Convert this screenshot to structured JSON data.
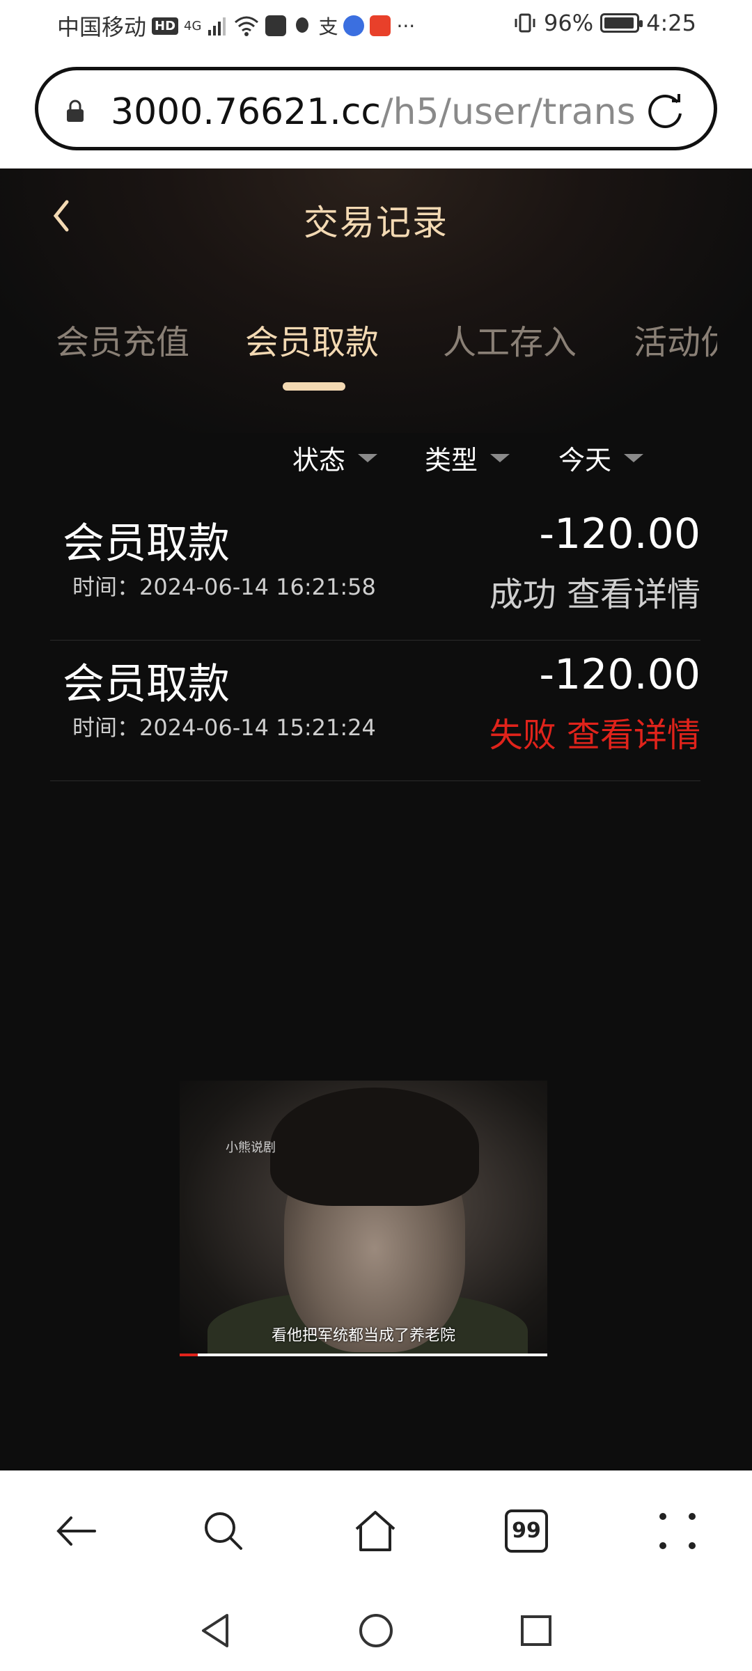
{
  "status_bar": {
    "carrier": "中国移动",
    "hd": "HD",
    "network": "4G",
    "battery_percent": "96%",
    "battery_level": 0.96,
    "time": "4:25"
  },
  "browser": {
    "url_host": "3000.76621.cc",
    "url_path": "/h5/user/trans",
    "tabs_count": "99"
  },
  "page": {
    "title": "交易记录",
    "tabs": [
      {
        "label": "会员充值",
        "active": false
      },
      {
        "label": "会员取款",
        "active": true
      },
      {
        "label": "人工存入",
        "active": false
      },
      {
        "label": "活动优",
        "active": false
      }
    ],
    "filters": [
      {
        "label": "状态"
      },
      {
        "label": "类型"
      },
      {
        "label": "今天"
      }
    ],
    "records": [
      {
        "title": "会员取款",
        "time": "时间：2024-06-14 16:21:58",
        "amount": "-120.00",
        "status": "成功",
        "detail_link": "查看详情",
        "status_color": "#cfcfcf"
      },
      {
        "title": "会员取款",
        "time": "时间：2024-06-14 15:21:24",
        "amount": "-120.00",
        "status": "失败",
        "detail_link": "查看详情",
        "status_color": "#e0231b"
      }
    ]
  },
  "video": {
    "watermark": "小熊说剧",
    "subtitle": "看他把军统都当成了养老院",
    "progress": 0.05
  },
  "colors": {
    "accent_gold": "#f3d9b3",
    "fail_red": "#e0231b",
    "page_bg": "#0d0d0d"
  }
}
